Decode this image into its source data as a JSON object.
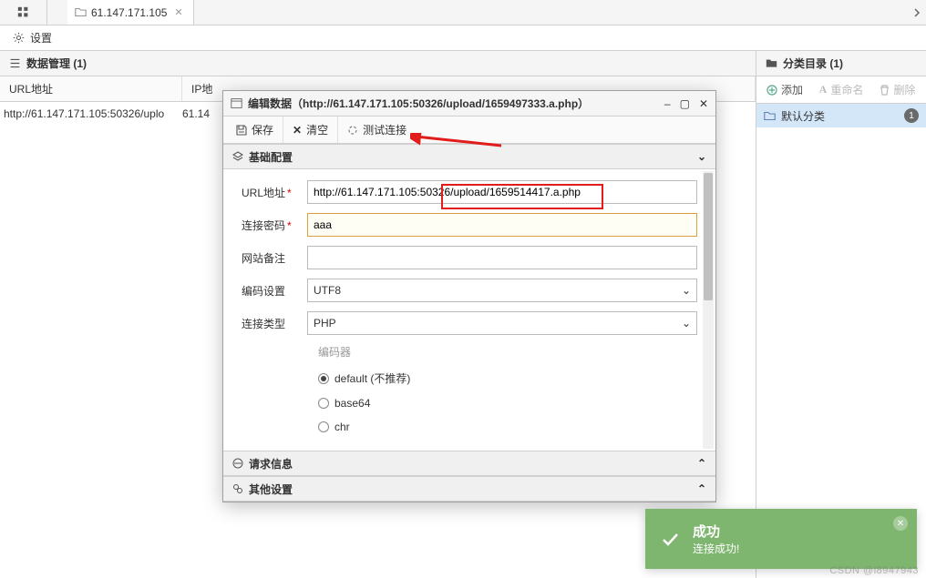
{
  "topbar": {
    "tab_label": "61.147.171.105"
  },
  "settings": {
    "label": "设置"
  },
  "left": {
    "panel_title": "数据管理 (1)",
    "col1": "URL地址",
    "col2": "IP地",
    "row1_url": "http://61.147.171.105:50326/uplo",
    "row1_ip": "61.14"
  },
  "right": {
    "panel_title": "分类目录 (1)",
    "add": "添加",
    "rename": "重命名",
    "delete": "删除",
    "item": "默认分类",
    "count": "1"
  },
  "dialog": {
    "title": "编辑数据（http://61.147.171.105:50326/upload/1659497333.a.php）",
    "save": "保存",
    "clear": "清空",
    "test": "测试连接",
    "section_basic": "基础配置",
    "section_req": "请求信息",
    "section_other": "其他设置",
    "fields": {
      "url_label": "URL地址",
      "url_value": "http://61.147.171.105:50326/upload/1659514417.a.php",
      "pwd_label": "连接密码",
      "pwd_value": "aaa",
      "note_label": "网站备注",
      "note_value": "",
      "enc_label": "编码设置",
      "enc_value": "UTF8",
      "type_label": "连接类型",
      "type_value": "PHP",
      "encoder_label": "编码器",
      "encoder_opts": [
        "default (不推荐)",
        "base64",
        "chr"
      ]
    }
  },
  "toast": {
    "title": "成功",
    "msg": "连接成功!"
  },
  "watermark": "CSDN @l8947943"
}
